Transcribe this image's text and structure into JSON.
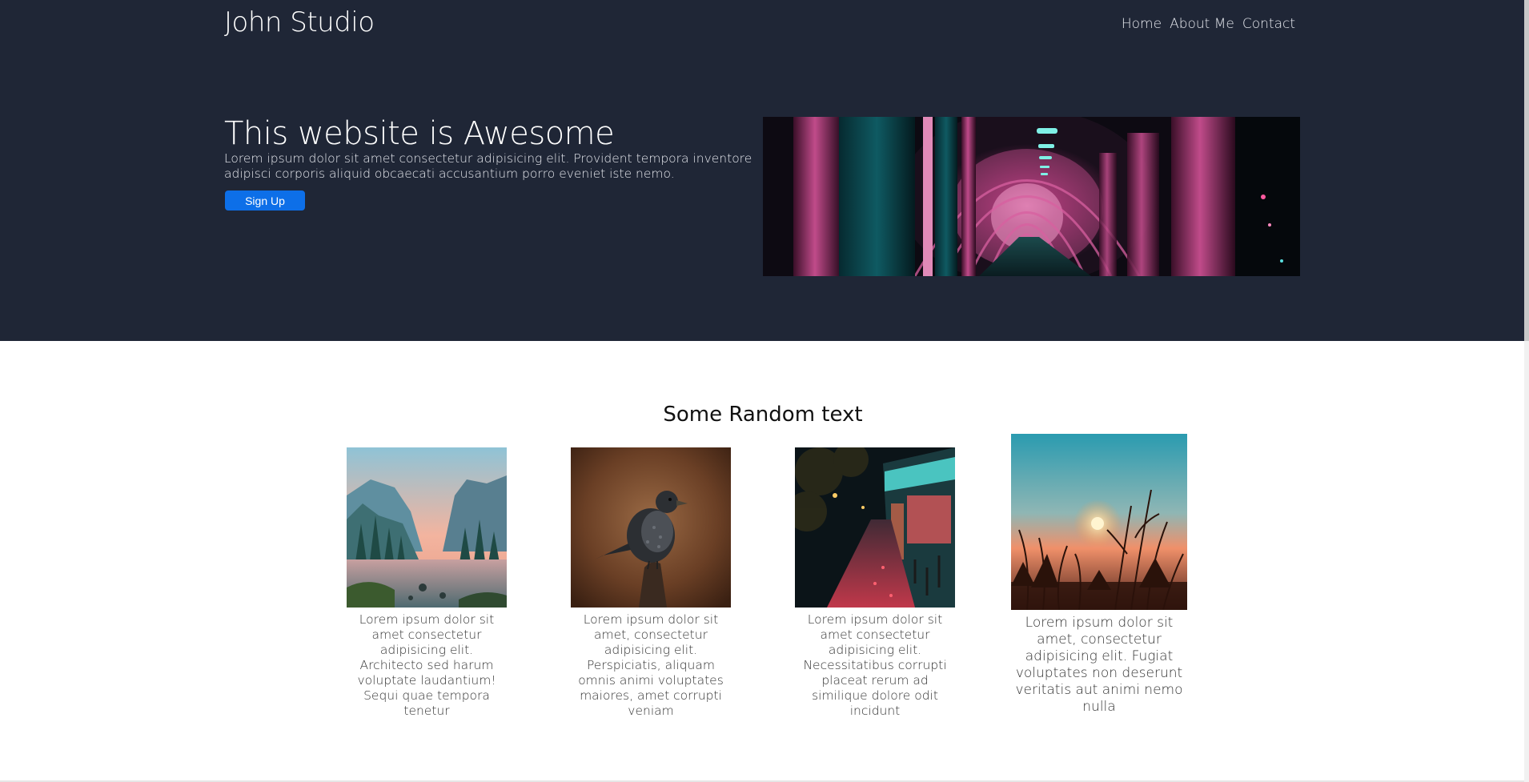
{
  "header": {
    "brand": "John Studio",
    "nav": [
      "Home",
      "About Me",
      "Contact"
    ]
  },
  "hero": {
    "title": "This website is Awesome",
    "text": "Lorem ipsum dolor sit amet consectetur adipisicing elit. Provident tempora inventore adipisci corporis aliquid obcaecati accusantium porro eveniet iste nemo.",
    "button": "Sign Up",
    "image": "corridor-photo"
  },
  "section": {
    "title": "Some Random text",
    "cards": [
      {
        "image": "mountain-lake-photo",
        "text": "Lorem ipsum dolor sit amet consectetur adipisicing elit. Architecto sed harum voluptate laudantium! Sequi quae tempora tenetur"
      },
      {
        "image": "bird-photo",
        "text": "Lorem ipsum dolor sit amet, consectetur adipisicing elit. Perspiciatis, aliquam omnis animi voluptates maiores, amet corrupti veniam"
      },
      {
        "image": "night-street-photo",
        "text": "Lorem ipsum dolor sit amet consectetur adipisicing elit. Necessitatibus corrupti placeat rerum ad similique dolore odit incidunt"
      },
      {
        "image": "sunset-grass-photo",
        "text": "Lorem ipsum dolor sit amet, consectetur adipisicing elit. Fugiat voluptates non deserunt veritatis aut animi nemo nulla"
      }
    ]
  },
  "colors": {
    "hero_bg": "#1f2636",
    "button": "#0d6fe8"
  }
}
